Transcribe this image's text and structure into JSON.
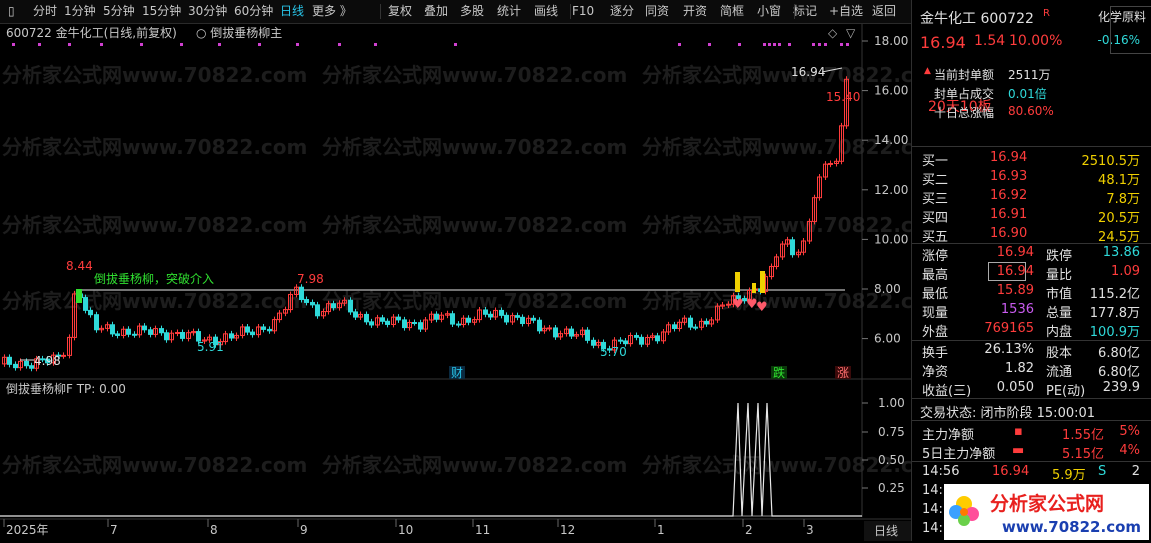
{
  "toolbar": {
    "items": [
      "分时",
      "1分钟",
      "5分钟",
      "15分钟",
      "30分钟",
      "60分钟",
      "日线",
      "更多 》",
      "复权",
      "叠加",
      "多股",
      "统计",
      "画线",
      "F10",
      "逐分",
      "同资",
      "开资",
      "简框",
      "小窗",
      "标记",
      "+自选",
      "返回"
    ]
  },
  "chart": {
    "header": "600722  金牛化工(日线,前复权)",
    "indicator_title": "倒拔垂杨柳主",
    "annotation": "倒拔垂杨柳，突破介入",
    "price_labels": {
      "p844": "8.44",
      "p798": "7.98",
      "p591": "5.91",
      "p570": "5.70",
      "p498": "4.98",
      "p1694": "16.94",
      "p1540": "15.40"
    },
    "y_axis": [
      "18.00",
      "16.00",
      "14.00",
      "12.00",
      "10.00",
      "8.00",
      "6.00"
    ],
    "event_marks": {
      "cai": "财",
      "die": "跌",
      "zhang": "涨"
    },
    "sub_header": "倒拔垂杨柳F  TP: 0.00",
    "sub_y_axis": [
      "1.00",
      "0.75",
      "0.50",
      "0.25"
    ],
    "x_axis": [
      "2025年",
      "7",
      "8",
      "9",
      "10",
      "11",
      "12",
      "1",
      "2",
      "3"
    ],
    "period_label": "日线",
    "watermark": "分析家公式网www.70822.com"
  },
  "chart_data": {
    "type": "candlestick",
    "title": "600722 金牛化工(日线,前复权)",
    "ylim": [
      4.5,
      18.8
    ],
    "annotated_prices": {
      "start_low": 4.98,
      "high_july": 8.44,
      "high_sept": 7.98,
      "low_aug": 5.91,
      "low_dec": 5.7,
      "last_high": 16.94,
      "prev_close_label": 15.4
    },
    "breakout_line": 7.9
  },
  "panel": {
    "title_name": "金牛化工",
    "title_code": "600722",
    "r_mark": "R",
    "industry_label": "化学原料",
    "industry_change": "-0.16%",
    "price": "16.94",
    "change": "1.54",
    "change_pct": "10.00%",
    "seal_label": "当前封单额",
    "seal_value": "2511万",
    "seal_ratio_label": "封单占成交",
    "seal_ratio_value": "0.01倍",
    "ten_day_label": "十日总涨幅",
    "ten_day_value": "80.60%",
    "streak": "20天10板",
    "bids": [
      {
        "label": "买一",
        "price": "16.94",
        "vol": "2510.5万"
      },
      {
        "label": "买二",
        "price": "16.93",
        "vol": "48.1万"
      },
      {
        "label": "买三",
        "price": "16.92",
        "vol": "7.8万"
      },
      {
        "label": "买四",
        "price": "16.91",
        "vol": "20.5万"
      },
      {
        "label": "买五",
        "price": "16.90",
        "vol": "24.5万"
      }
    ],
    "stats": [
      {
        "l1": "涨停",
        "v1": "16.94",
        "l2": "跌停",
        "v2": "13.86"
      },
      {
        "l1": "最高",
        "v1": "16.94",
        "l2": "量比",
        "v2": "1.09"
      },
      {
        "l1": "最低",
        "v1": "15.89",
        "l2": "市值",
        "v2": "115.2亿"
      },
      {
        "l1": "现量",
        "v1": "1536",
        "l2": "总量",
        "v2": "177.8万"
      },
      {
        "l1": "外盘",
        "v1": "769165",
        "l2": "内盘",
        "v2": "100.9万"
      }
    ],
    "stats2": [
      {
        "l1": "换手",
        "v1": "26.13%",
        "l2": "股本",
        "v2": "6.80亿"
      },
      {
        "l1": "净资",
        "v1": "1.82",
        "l2": "流通",
        "v2": "6.80亿"
      },
      {
        "l1": "收益(三)",
        "v1": "0.050",
        "l2": "PE(动)",
        "v2": "239.9"
      }
    ],
    "trade_status": "交易状态: 闭市阶段 15:00:01",
    "main_net_label": "主力净额",
    "main_net_value": "1.55亿",
    "main_net_pct": "5%",
    "five_day_label": "5日主力净额",
    "five_day_value": "5.15亿",
    "five_day_pct": "4%",
    "tick_time": "14:56",
    "tick_price": "16.94",
    "tick_vol": "5.9万",
    "tick_side": "S",
    "tick_count": "2",
    "more_times": [
      "14:",
      "14:",
      "14:"
    ]
  },
  "logo": {
    "text": "分析家公式网",
    "url": "www.70822.com"
  },
  "colors": {
    "up": "#ff3c3c",
    "down": "#2fd9d9",
    "accent": "#28c4e8",
    "highlight": "#f0d000"
  }
}
